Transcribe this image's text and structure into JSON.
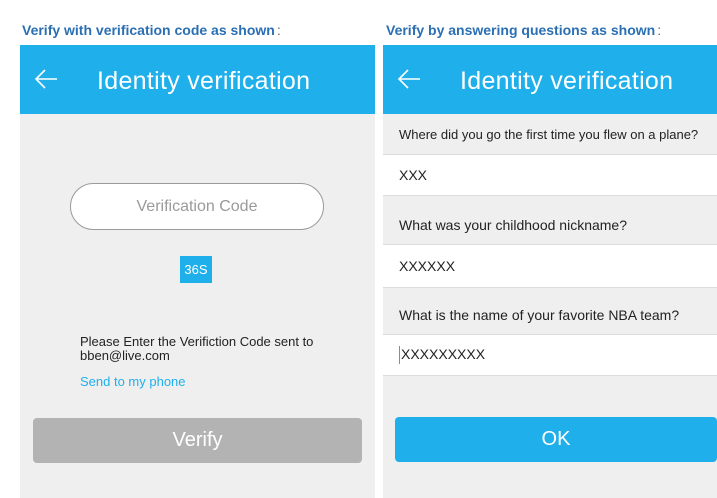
{
  "captions": {
    "left": "Verify with verification code as shown",
    "left_colon": ":",
    "right": "Verify by answering questions as shown",
    "right_colon": ":"
  },
  "left_screen": {
    "title": "Identity verification",
    "code_placeholder": "Verification Code",
    "timer": "36S",
    "instruction_line1": "Please Enter the Verifiction Code sent to",
    "instruction_line2": "bben@live.com",
    "send_to_phone": "Send to my phone",
    "verify_button": "Verify"
  },
  "right_screen": {
    "title": "Identity verification",
    "questions": [
      {
        "question": "Where did you go the first time you flew on a plane?",
        "answer": "XXX"
      },
      {
        "question": "What was your childhood nickname?",
        "answer": "XXXXXX"
      },
      {
        "question": "What is the name of your favorite NBA team?",
        "answer": "XXXXXXXXX"
      }
    ],
    "ok_button": "OK"
  },
  "colors": {
    "accent": "#1fb0ec",
    "disabled_button": "#b3b3b3",
    "caption": "#2a6fb4"
  },
  "icons": {
    "back": "back-arrow-icon"
  }
}
